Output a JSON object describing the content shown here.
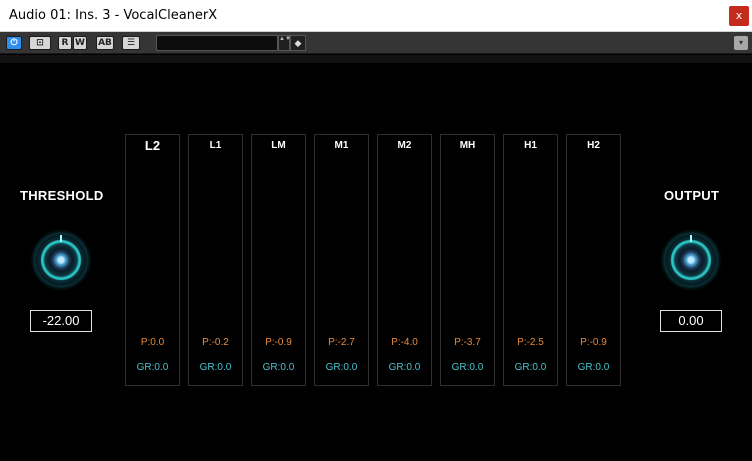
{
  "window": {
    "title": "Audio 01: Ins. 3 - VocalCleanerX",
    "close_label": "x"
  },
  "toolbar": {
    "power_label": "⏻",
    "bypass_label": "⊡",
    "read_label": "R",
    "write_label": "W",
    "ab_label": "AB",
    "compare_label": "☰",
    "preset_value": "",
    "arrows_label": "▲▼",
    "tag_label": "◆",
    "menu_label": "▾"
  },
  "threshold": {
    "label": "THRESHOLD",
    "value": "-22.00"
  },
  "output": {
    "label": "OUTPUT",
    "value": "0.00"
  },
  "bands": [
    {
      "name": "L2",
      "peak": "P:0.0",
      "gr": "GR:0.0"
    },
    {
      "name": "L1",
      "peak": "P:-0.2",
      "gr": "GR:0.0"
    },
    {
      "name": "LM",
      "peak": "P:-0.9",
      "gr": "GR:0.0"
    },
    {
      "name": "M1",
      "peak": "P:-2.7",
      "gr": "GR:0.0"
    },
    {
      "name": "M2",
      "peak": "P:-4.0",
      "gr": "GR:0.0"
    },
    {
      "name": "MH",
      "peak": "P:-3.7",
      "gr": "GR:0.0"
    },
    {
      "name": "H1",
      "peak": "P:-2.5",
      "gr": "GR:0.0"
    },
    {
      "name": "H2",
      "peak": "P:-0.9",
      "gr": "GR:0.0"
    }
  ],
  "colors": {
    "peak": "#e88a3a",
    "gain_reduction": "#49c3cc",
    "knob_glow": "#2ec7c7",
    "close": "#c42b1c",
    "power": "#2f8ff0"
  }
}
